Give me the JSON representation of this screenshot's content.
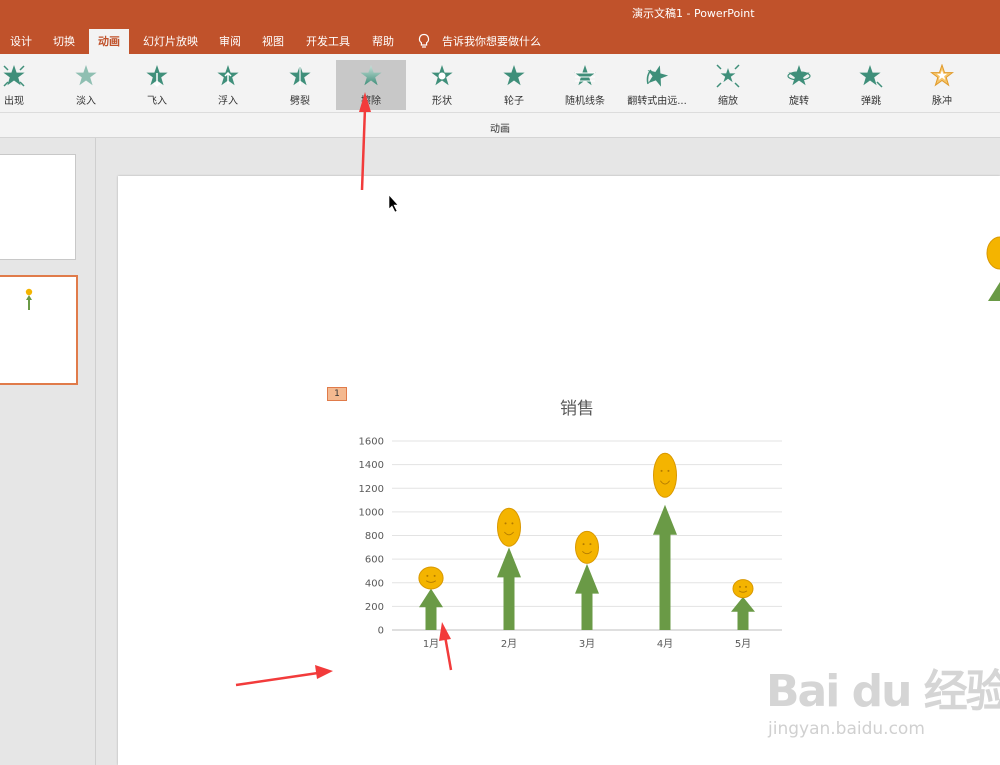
{
  "window": {
    "title": "演示文稿1  -  PowerPoint"
  },
  "menu": {
    "tabs": [
      {
        "label": "设计"
      },
      {
        "label": "切换"
      },
      {
        "label": "动画"
      },
      {
        "label": "幻灯片放映"
      },
      {
        "label": "审阅"
      },
      {
        "label": "视图"
      },
      {
        "label": "开发工具"
      },
      {
        "label": "帮助"
      }
    ],
    "active": "动画",
    "tell_me": "告诉我你想要做什么"
  },
  "ribbon": {
    "animations": [
      {
        "label": "出现"
      },
      {
        "label": "淡入"
      },
      {
        "label": "飞入"
      },
      {
        "label": "浮入"
      },
      {
        "label": "劈裂"
      },
      {
        "label": "擦除"
      },
      {
        "label": "形状"
      },
      {
        "label": "轮子"
      },
      {
        "label": "随机线条"
      },
      {
        "label": "翻转式由远..."
      },
      {
        "label": "缩放"
      },
      {
        "label": "旋转"
      },
      {
        "label": "弹跳"
      },
      {
        "label": "脉冲"
      }
    ],
    "selected": "擦除",
    "group_label": "动画"
  },
  "slide": {
    "animation_tag": "1"
  },
  "chart_data": {
    "type": "bar",
    "title": "销售",
    "categories": [
      "1月",
      "2月",
      "3月",
      "4月",
      "5月"
    ],
    "values": [
      350,
      700,
      560,
      1060,
      280
    ],
    "marker_values": [
      440,
      870,
      700,
      1310,
      350
    ],
    "yticks": [
      "0",
      "200",
      "400",
      "600",
      "800",
      "1000",
      "1200",
      "1400",
      "1600"
    ],
    "ylim": [
      0,
      1600
    ],
    "grid": true,
    "bar_color": "#6a9a46",
    "marker_color": "#f4b400"
  },
  "watermark": {
    "logo": "Bai du 经验",
    "url": "jingyan.baidu.com"
  },
  "colors": {
    "accent": "#c0522b",
    "arrow": "#f23b3b"
  }
}
